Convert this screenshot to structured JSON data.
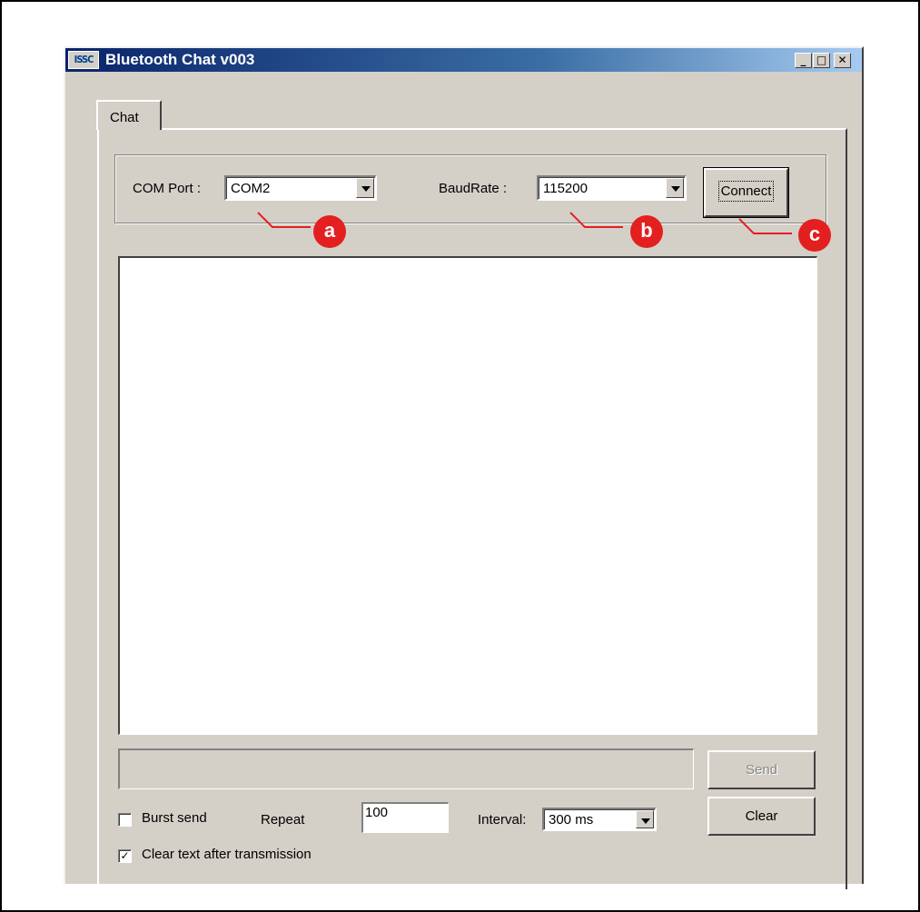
{
  "window": {
    "app_icon_text": "ISSC",
    "title": "Bluetooth Chat v003",
    "minimize_glyph": "_",
    "maximize_glyph": "□",
    "close_glyph": "✕"
  },
  "tabs": [
    {
      "label": "Chat",
      "selected": true
    }
  ],
  "connection": {
    "com_port_label": "COM Port :",
    "com_port_value": "COM2",
    "baud_rate_label": "BaudRate :",
    "baud_rate_value": "115200",
    "connect_label": "Connect"
  },
  "chat": {
    "log_text": "",
    "message_input_value": ""
  },
  "actions": {
    "send_label": "Send",
    "send_enabled": false,
    "clear_label": "Clear"
  },
  "options": {
    "burst_send_label": "Burst send",
    "burst_send_checked": false,
    "repeat_label": "Repeat",
    "repeat_value": "100",
    "interval_label": "Interval:",
    "interval_value": "300 ms",
    "clear_after_tx_label": "Clear text after transmission",
    "clear_after_tx_checked": true
  },
  "callouts": [
    {
      "letter": "a",
      "target": "com-port-combo"
    },
    {
      "letter": "b",
      "target": "baud-rate-combo"
    },
    {
      "letter": "c",
      "target": "connect-button"
    }
  ],
  "colors": {
    "window_face": "#d4d0c8",
    "titlebar_start": "#0a246a",
    "titlebar_end": "#a6caf0",
    "callout_red": "#e41f1f"
  }
}
